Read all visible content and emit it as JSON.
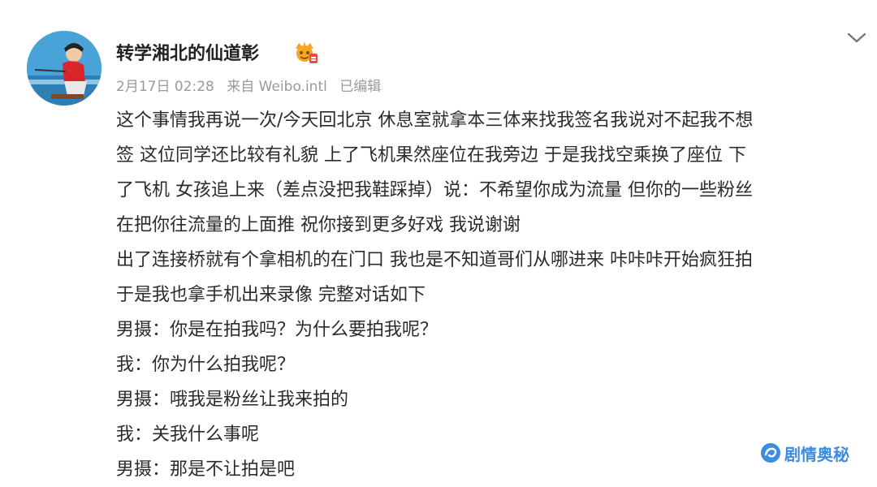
{
  "post": {
    "author": "转学湘北的仙道彰",
    "date": "2月17日 02:28",
    "source": "来自 Weibo.intl",
    "edited": "已编辑",
    "lines": [
      "这个事情我再说一次/今天回北京 休息室就拿本三体来找我签名我说对不起我不想",
      "签 这位同学还比较有礼貌 上了飞机果然座位在我旁边 于是我找空乘换了座位 下",
      "了飞机 女孩追上来（差点没把我鞋踩掉）说：不希望你成为流量 但你的一些粉丝",
      "在把你往流量的上面推 祝你接到更多好戏 我说谢谢",
      "出了连接桥就有个拿相机的在门口 我也是不知道哥们从哪进来 咔咔咔开始疯狂拍",
      "于是我也拿手机出来录像 完整对话如下",
      "男摄：你是在拍我吗？为什么要拍我呢？",
      "我：你为什么拍我呢？",
      "男摄：哦我是粉丝让我来拍的",
      "我：关我什么事呢",
      "男摄：那是不让拍是吧"
    ]
  },
  "watermark": {
    "text": "剧情奥秘"
  },
  "icons": {
    "avatar": "avatar-cartoon-icon",
    "vip": "vip-crown-badge-icon",
    "menu": "chevron-down-icon",
    "watermark": "swirl-logo-icon"
  },
  "colors": {
    "meta_gray": "#9a9a9a",
    "text": "#2b2b2b",
    "watermark_blue": "#3c8de0",
    "vip_orange": "#f5a623"
  }
}
